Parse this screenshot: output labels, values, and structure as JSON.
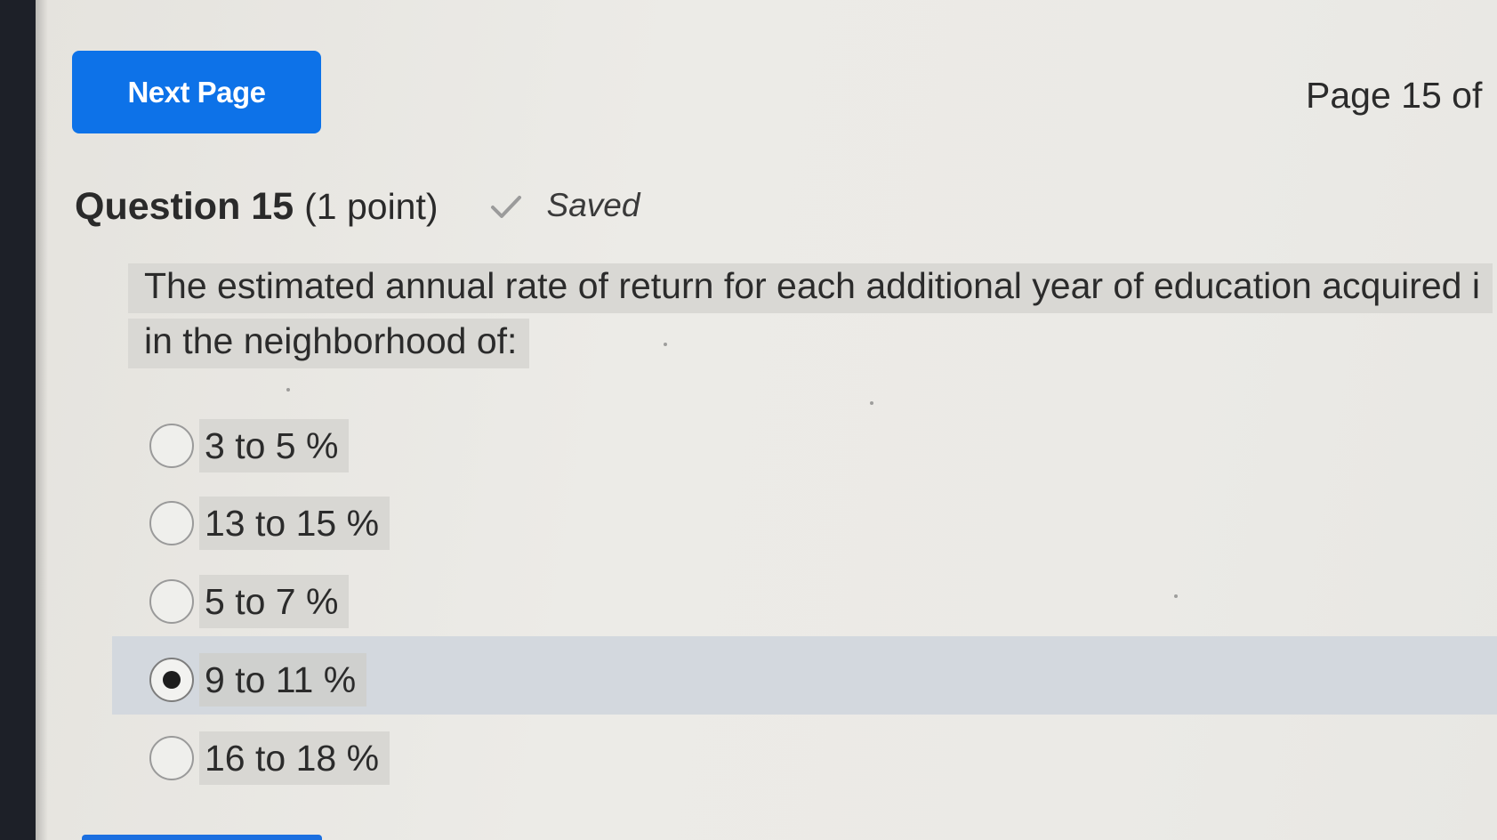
{
  "navigation": {
    "next_page_label": "Next Page",
    "page_indicator": "Page 15 of"
  },
  "question": {
    "title": "Question 15",
    "points": "(1 point)",
    "save_status": "Saved",
    "prompt_line1": "The estimated annual rate of return for each additional year of education acquired i",
    "prompt_line2": "in the neighborhood of:"
  },
  "options": [
    {
      "label": "3 to 5 %",
      "selected": false
    },
    {
      "label": "13 to 15 %",
      "selected": false
    },
    {
      "label": "5 to 7 %",
      "selected": false
    },
    {
      "label": "9 to 11 %",
      "selected": true
    },
    {
      "label": "16 to 18 %",
      "selected": false
    }
  ],
  "colors": {
    "accent": "#0d72e8",
    "selected_row": "#d3d8de",
    "page_background": "#ebeae6"
  },
  "icons": {
    "saved": "checkmark-icon"
  }
}
